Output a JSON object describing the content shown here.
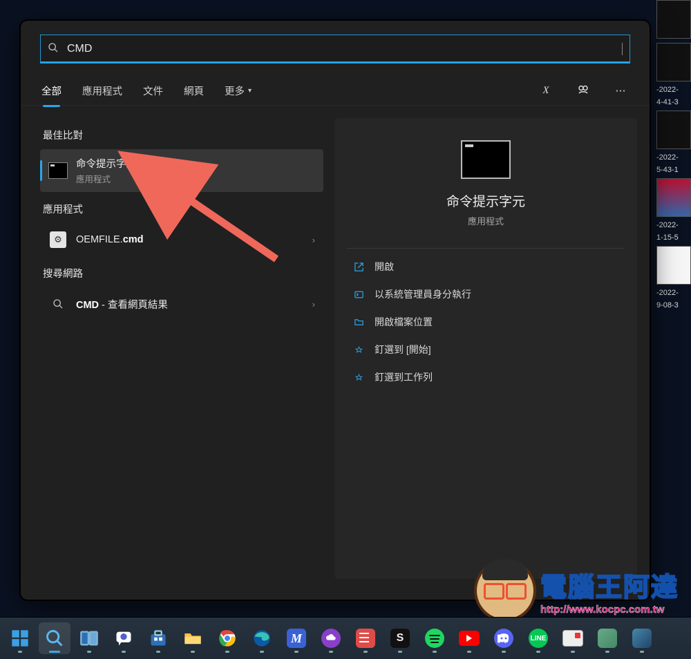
{
  "search": {
    "query": "CMD",
    "placeholder": ""
  },
  "filters": {
    "tabs": [
      "全部",
      "應用程式",
      "文件",
      "網頁",
      "更多"
    ],
    "active_index": 0
  },
  "toolbar_right": {
    "x_label": "X",
    "cortana_label": "Cortana",
    "more_label": "更多選項"
  },
  "sections": {
    "best_match": "最佳比對",
    "apps": "應用程式",
    "search_web": "搜尋網路"
  },
  "results": {
    "best": {
      "title": "命令提示字元",
      "subtitle": "應用程式"
    },
    "apps": [
      {
        "title_prefix": "OEMFILE.",
        "title_bold": "cmd"
      }
    ],
    "web": [
      {
        "title_bold": "CMD",
        "title_suffix": " - 查看網頁結果"
      }
    ]
  },
  "preview": {
    "title": "命令提示字元",
    "subtitle": "應用程式",
    "actions": [
      {
        "icon": "open",
        "label": "開啟"
      },
      {
        "icon": "admin",
        "label": "以系統管理員身分執行"
      },
      {
        "icon": "folder",
        "label": "開啟檔案位置"
      },
      {
        "icon": "pin-start",
        "label": "釘選到 [開始]"
      },
      {
        "icon": "pin-taskbar",
        "label": "釘選到工作列"
      }
    ]
  },
  "desktop_thumbs": [
    "-2022-",
    "4-41-3",
    "",
    "",
    "-2022-",
    "5-43-1",
    "",
    "",
    "-2022-",
    "1-15-5",
    "",
    "",
    "-2022-",
    "9-08-3"
  ],
  "watermark": {
    "text": "電腦王阿達",
    "url": "http://www.kocpc.com.tw"
  },
  "taskbar": [
    "start",
    "search",
    "taskview",
    "chat",
    "store",
    "explorer",
    "chrome",
    "edge",
    "m-app",
    "cloud",
    "todoist",
    "s-app",
    "spotify",
    "youtube",
    "discord",
    "line",
    "recorder",
    "app1",
    "app2"
  ]
}
